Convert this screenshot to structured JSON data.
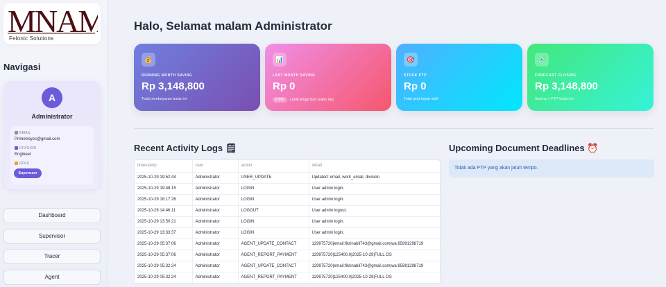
{
  "brand": {
    "logo_text": "MNAMA",
    "subtitle": "Felonic Solutions"
  },
  "sidebar": {
    "nav_title": "Navigasi",
    "profile": {
      "avatar_letter": "A",
      "name": "Administrator",
      "email_label": "EMAIL",
      "email": "Primetroyes@gmail.com",
      "division_label": "DIVISION",
      "division": "Engineer",
      "role_label": "ROLE",
      "role": "Superuser"
    },
    "nav_items": [
      {
        "label": "Dashboard"
      },
      {
        "label": "Supervisor"
      },
      {
        "label": "Tracer"
      },
      {
        "label": "Agent"
      }
    ]
  },
  "header": {
    "greeting": "Halo, Selamat malam Administrator"
  },
  "cards": [
    {
      "label": "RUNNING MONTH SAVING",
      "value": "Rp 3,148,800",
      "sub": "Total pembayaran bulan ini",
      "icon": "money-bag-icon",
      "color_from": "#6f7fe0",
      "color_to": "#7a4fb0"
    },
    {
      "label": "LAST MONTH SAVING",
      "value": "Rp 0",
      "badge": "0.0%",
      "sub": "Lebih tinggi dari bulan lalu",
      "icon": "bar-chart-icon",
      "color_from": "#f08ee8",
      "color_to": "#f5576c"
    },
    {
      "label": "STOCK PTP",
      "value": "Rp 0",
      "sub": "Total janji bayar aktif",
      "icon": "target-icon",
      "color_from": "#4fb0fe",
      "color_to": "#00e8fe"
    },
    {
      "label": "FORECAST CLOSING",
      "value": "Rp 3,148,800",
      "sub": "Saving + PTP bulan ini",
      "icon": "syringe-icon",
      "color_from": "#43e77b",
      "color_to": "#36f3d8"
    }
  ],
  "activity": {
    "title": "Recent Activity Logs",
    "title_emoji": "🗒",
    "columns": [
      "timestamp",
      "user",
      "action",
      "detail"
    ],
    "rows": [
      [
        "2025-10-29 19:52:44",
        "Administrator",
        "USER_UPDATE",
        "Updated: email, work_email, division"
      ],
      [
        "2025-10-29 19:48:15",
        "Administrator",
        "LOGIN",
        "User admin login."
      ],
      [
        "2025-10-29 18:17:26",
        "Administrator",
        "LOGIN",
        "User admin login."
      ],
      [
        "2025-10-29 14:46:11",
        "Administrator",
        "LOGOUT",
        "User admin logout."
      ],
      [
        "2025-10-29 13:50:21",
        "Administrator",
        "LOGIN",
        "User admin login."
      ],
      [
        "2025-10-29 13:33:37",
        "Administrator",
        "LOGIN",
        "User admin login."
      ],
      [
        "2025-10-29 05:37:06",
        "Administrator",
        "AGENT_UPDATE_CONTACT",
        "129975720|email:fikrinabil743@gmail.com|wa:85891298719"
      ],
      [
        "2025-10-29 05:37:06",
        "Administrator",
        "AGENT_REPORT_PAYMENT",
        "129975720|125400.0|2025-10-29|FULL OS"
      ],
      [
        "2025-10-29 05:32:24",
        "Administrator",
        "AGENT_UPDATE_CONTACT",
        "129975720|email:fikrinabil743@gmail.com|wa:85891298719"
      ],
      [
        "2025-10-29 05:32:24",
        "Administrator",
        "AGENT_REPORT_PAYMENT",
        "129975720|125400.0|2025-10-29|FULL OS"
      ]
    ]
  },
  "deadlines": {
    "title": "Upcoming Document Deadlines",
    "title_emoji": "⏰",
    "empty_message": "Tidak ada PTP yang akan jatuh tempo."
  }
}
